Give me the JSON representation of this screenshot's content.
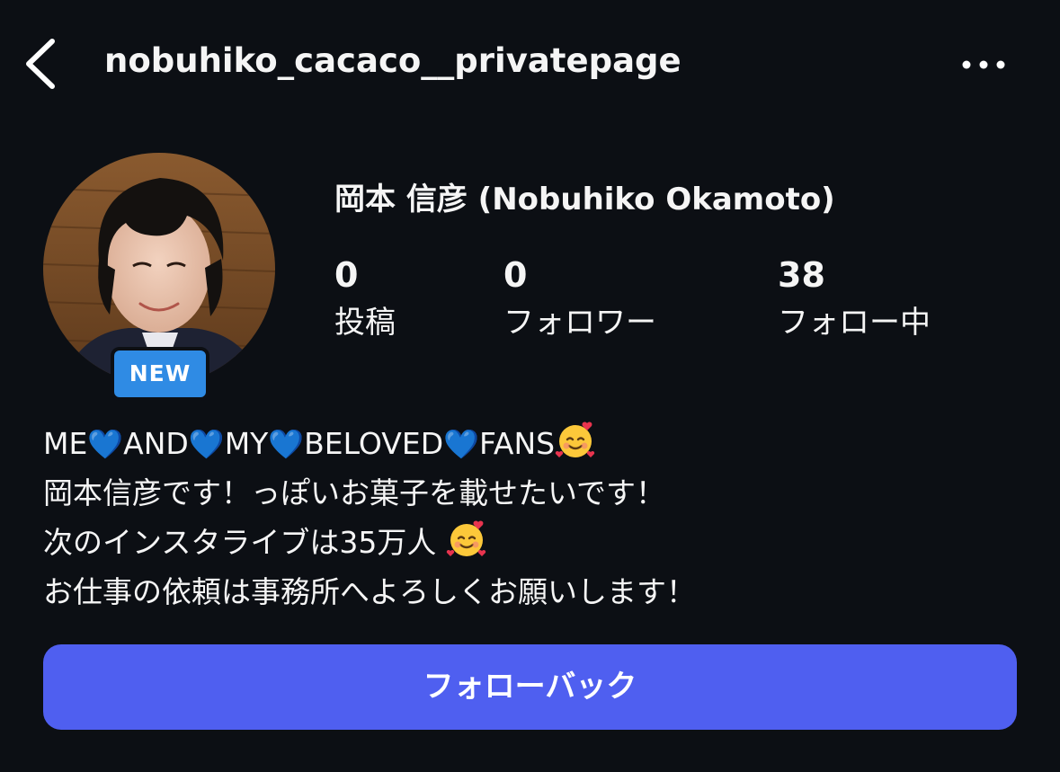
{
  "header": {
    "username": "nobuhiko_cacaco__privatepage",
    "back_icon": "chevron-left-icon",
    "more_icon": "more-horizontal-icon"
  },
  "profile": {
    "badge": "NEW",
    "full_name": "岡本 信彦  (Nobuhiko Okamoto)",
    "stats": [
      {
        "value": "0",
        "label": "投稿"
      },
      {
        "value": "0",
        "label": "フォロワー"
      },
      {
        "value": "38",
        "label": "フォロー中"
      }
    ]
  },
  "bio": {
    "line1_words": [
      "ME",
      "AND",
      "MY",
      "BELOVED",
      "FANS"
    ],
    "line2": "岡本信彦です！っぽいお菓子を載せたいです！",
    "line3": "次のインスタライブは35万人 ",
    "line4": "お仕事の依頼は事務所へよろしくお願いします！",
    "heart_emoji": "💙"
  },
  "actions": {
    "follow_back_label": "フォローバック"
  },
  "colors": {
    "background": "#0c0f14",
    "button": "#4f5ff0",
    "badge": "#2f8be4",
    "heart": "#1d66ff"
  }
}
